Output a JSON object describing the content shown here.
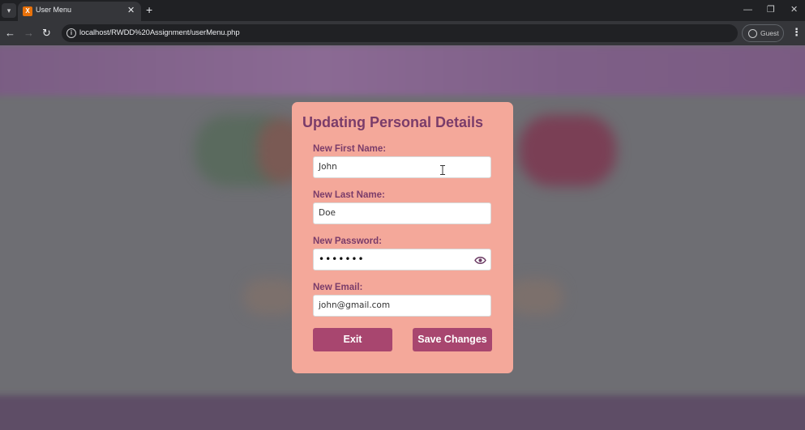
{
  "browser": {
    "tab_title": "User Menu",
    "tab_close_glyph": "✕",
    "new_tab_glyph": "+",
    "url": "localhost/RWDD%20Assignment/userMenu.php",
    "profile_label": "Guest",
    "icons": [
      "tab-list-icon",
      "favicon-icon",
      "back-icon",
      "forward-icon",
      "reload-icon",
      "site-info-icon",
      "profile-icon",
      "more-menu-icon",
      "minimize-icon",
      "restore-icon",
      "close-window-icon"
    ]
  },
  "modal": {
    "title": "Updating Personal Details",
    "fields": [
      {
        "label": "New First Name:",
        "value": "John"
      },
      {
        "label": "New Last Name:",
        "value": "Doe"
      },
      {
        "label": "New Password:",
        "value": "•••••••"
      },
      {
        "label": "New Email:",
        "value": "john@gmail.com"
      }
    ],
    "exit_label": "Exit",
    "save_label": "Save Changes"
  },
  "colors": {
    "modal_bg": "#f4a89a",
    "title_text": "#7a3c6a",
    "button_bg": "#a8466f",
    "overlay": "#6e6e73"
  }
}
